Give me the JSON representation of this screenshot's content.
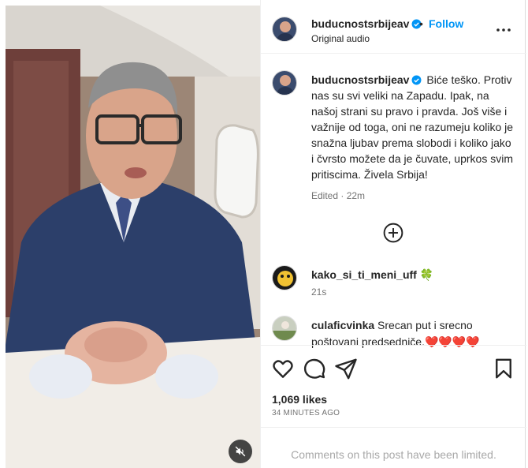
{
  "post": {
    "username": "buducnostsrbijeav",
    "follow_label": "Follow",
    "audio_label": "Original audio",
    "separator": "•"
  },
  "caption": {
    "username": "buducnostsrbijeav",
    "text": "Biće teško. Protiv nas su svi veliki na Zapadu. Ipak, na našoj strani su pravo i pravda. Još više i važnije od toga, oni ne razumeju koliko je snažna ljubav prema slobodi i koliko jako i čvrsto možete da je čuvate, uprkos svim pritiscima. Živela Srbija!",
    "edited": "Edited · 22m"
  },
  "comments": [
    {
      "username": "kako_si_ti_meni_uff",
      "text": "🍀",
      "time": "21s"
    },
    {
      "username": "culaficvinka",
      "text": "Srecan put i srecno poštovani predsedniče.❤️❤️❤️❤️",
      "time": ""
    }
  ],
  "stats": {
    "likes": "1,069 likes",
    "posted": "34 MINUTES AGO"
  },
  "footer": {
    "limited": "Comments on this post have been limited."
  },
  "icons": {
    "verified": "verified-badge-icon",
    "more": "more-options-icon",
    "load_more": "plus-circle-icon",
    "like": "heart-icon",
    "comment": "comment-icon",
    "share": "paper-plane-icon",
    "save": "bookmark-icon",
    "mute": "speaker-muted-icon"
  },
  "colors": {
    "accent": "#0095f6",
    "verified": "#0095f6",
    "muted_text": "#737373",
    "limited_text": "#a8a8a8"
  }
}
